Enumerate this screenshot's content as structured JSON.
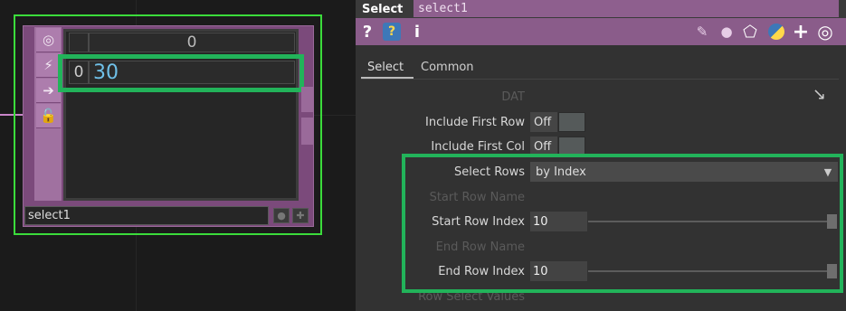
{
  "network": {
    "node": {
      "name": "select1",
      "table": {
        "column_header": "0",
        "row_index": "0",
        "cell_value": "30"
      }
    }
  },
  "panel": {
    "op_type": "Select",
    "op_name": "select1",
    "toolbar_icons": [
      "help-icon",
      "python-help-icon",
      "info-icon",
      "pencil-icon",
      "comment-icon",
      "clone-icon",
      "python-icon",
      "add-icon",
      "target-icon"
    ],
    "tabs": [
      {
        "label": "Select",
        "active": true
      },
      {
        "label": "Common",
        "active": false
      }
    ],
    "params": {
      "dat_label": "DAT",
      "include_first_row": {
        "label": "Include First Row",
        "value": "Off"
      },
      "include_first_col": {
        "label": "Include First Col",
        "value": "Off"
      },
      "select_rows": {
        "label": "Select Rows",
        "value": "by Index"
      },
      "start_row_name": {
        "label": "Start Row Name"
      },
      "start_row_index": {
        "label": "Start Row Index",
        "value": "10"
      },
      "end_row_name": {
        "label": "End Row  Name"
      },
      "end_row_index": {
        "label": "End Row Index",
        "value": "10"
      },
      "row_select_values": {
        "label": "Row Select Values"
      }
    }
  },
  "colors": {
    "highlight_green": "#22b35a",
    "selection_green": "#3bdc3b",
    "node_purple": "#7b4a7b",
    "toolbar_purple": "#8a5c8a",
    "cell_value_blue": "#6fc0e8"
  }
}
